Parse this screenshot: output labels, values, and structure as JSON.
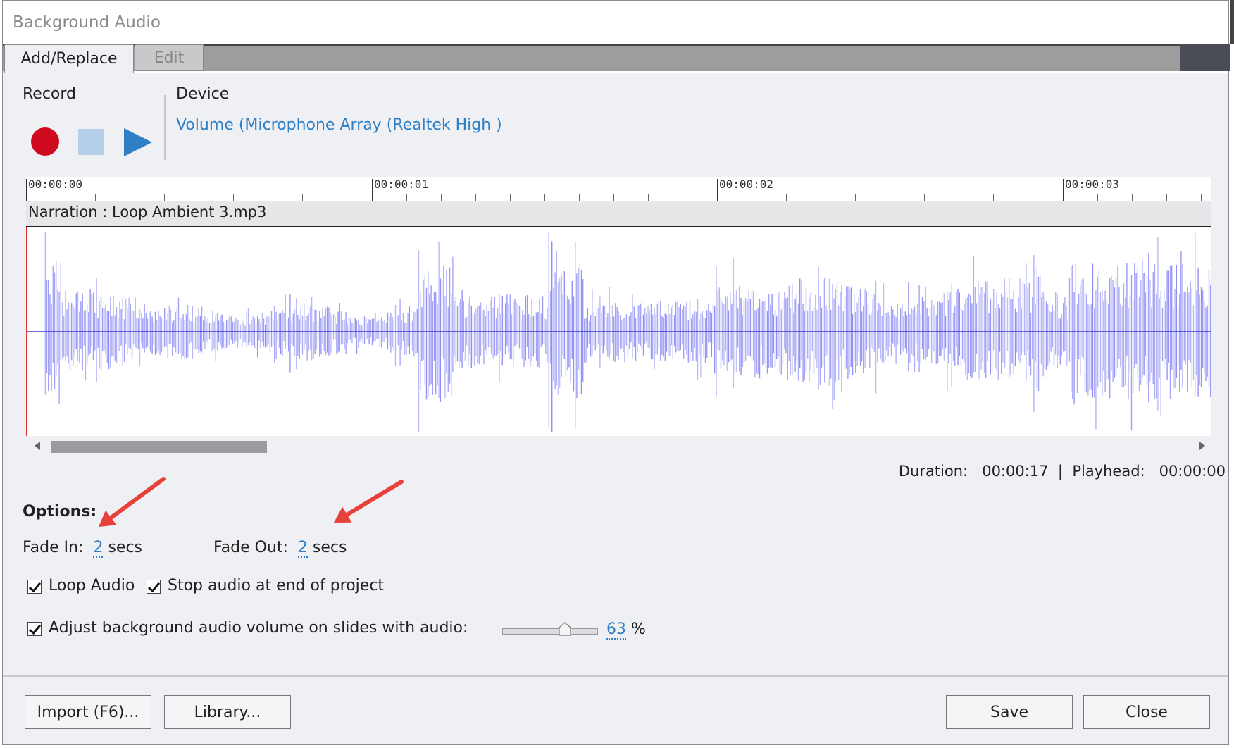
{
  "window": {
    "title": "Background Audio"
  },
  "tabs": [
    {
      "label": "Add/Replace",
      "active": true
    },
    {
      "label": "Edit",
      "active": false
    }
  ],
  "record": {
    "heading": "Record",
    "buttons": [
      "record-icon",
      "stop-icon",
      "play-icon"
    ]
  },
  "device": {
    "heading": "Device",
    "value": "Volume (Microphone Array (Realtek High )"
  },
  "timeline": {
    "ruler_labels": [
      "00:00:00",
      "00:00:01",
      "00:00:02",
      "00:00:03"
    ],
    "track_label": "Narration : Loop Ambient 3.mp3",
    "waveform_color": "#8f8ff5",
    "playhead_color": "#e03030"
  },
  "status": {
    "duration_label": "Duration:",
    "duration_value": "00:00:17",
    "separator": "|",
    "playhead_label": "Playhead:",
    "playhead_value": "00:00:00"
  },
  "options": {
    "heading": "Options:",
    "fade_in_label": "Fade In:",
    "fade_in_value": "2",
    "fade_in_unit": "secs",
    "fade_out_label": "Fade Out:",
    "fade_out_value": "2",
    "fade_out_unit": "secs",
    "loop_audio": {
      "label": "Loop Audio",
      "checked": true
    },
    "stop_audio": {
      "label": "Stop audio at end of project",
      "checked": true
    },
    "adjust_volume": {
      "label": "Adjust background audio volume on slides with audio:",
      "checked": true
    },
    "volume_value": "63",
    "volume_unit": "%",
    "volume_fraction": 0.63
  },
  "buttons": {
    "import": "Import (F6)...",
    "library": "Library...",
    "save": "Save",
    "close": "Close"
  },
  "accent_color": "#2e7fc6",
  "annotation_arrow_color": "#e8413c"
}
